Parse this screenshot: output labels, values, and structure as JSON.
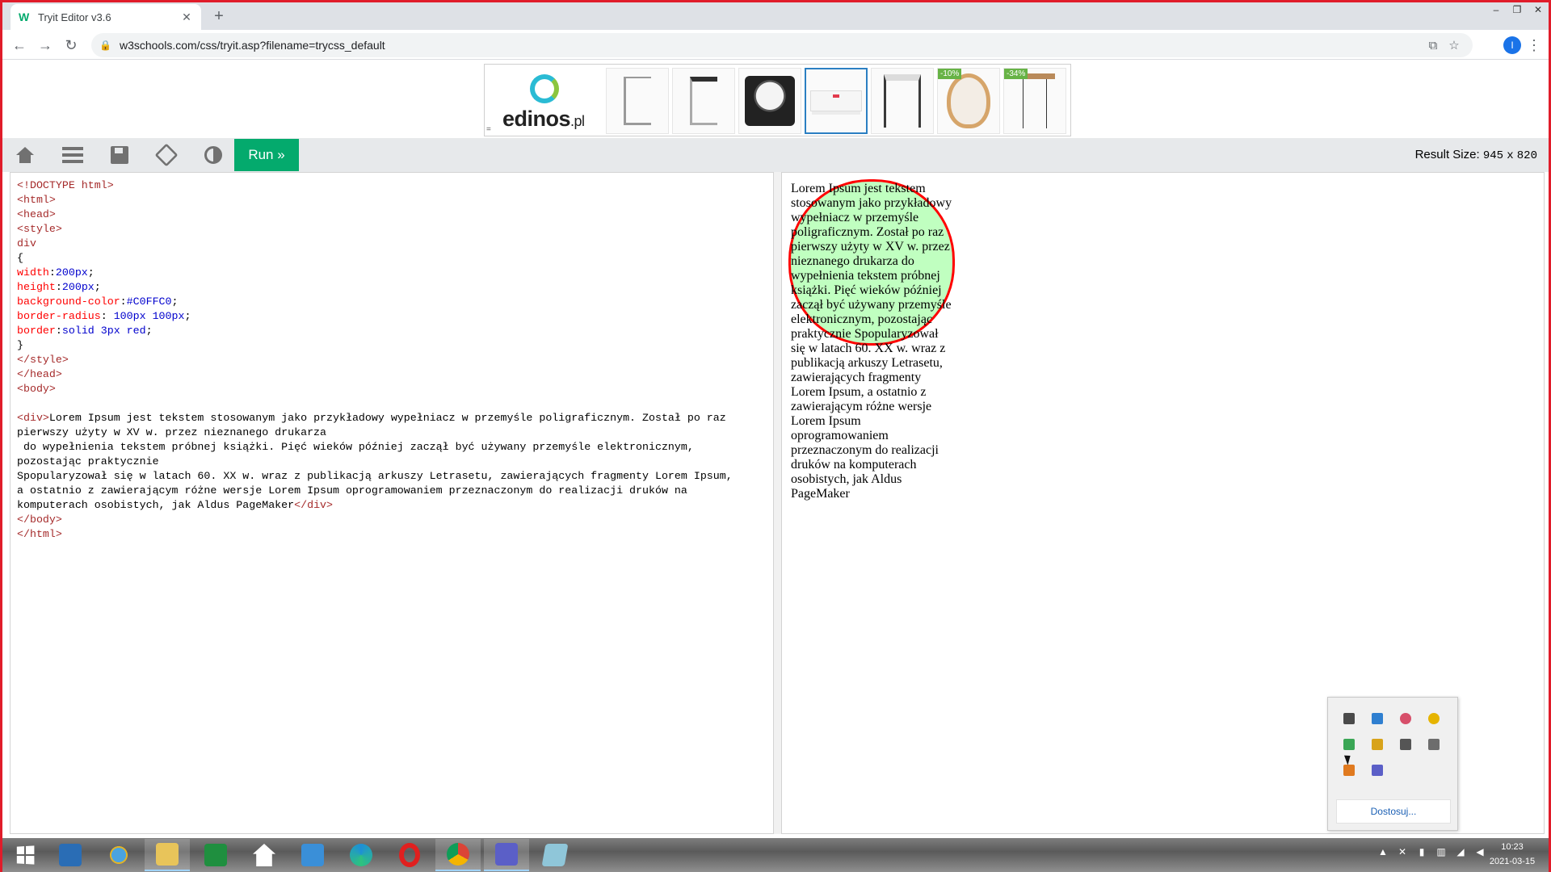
{
  "browser": {
    "tab_title": "Tryit Editor v3.6",
    "favicon_text": "W",
    "tab_close": "✕",
    "new_tab": "+",
    "window_controls": [
      "–",
      "❐",
      "✕"
    ],
    "url": "w3schools.com/css/tryit.asp?filename=trycss_default",
    "profile_initial": "I"
  },
  "ad": {
    "brand": "edinos",
    "brand_suffix": ".pl",
    "discount_badges": [
      "-10%",
      "-34%"
    ]
  },
  "tryit": {
    "run_label": "Run »",
    "result_size_label": "Result Size:",
    "result_width": "945",
    "result_times": "x",
    "result_height": "820"
  },
  "code": {
    "lines": [
      "<!DOCTYPE html>",
      "<html>",
      "<head>",
      "<style>",
      "div",
      "{",
      "width:200px;",
      "height:200px;",
      "background-color:#C0FFC0;",
      "border-radius: 100px 100px;",
      "border:solid 3px red;",
      "}",
      "</style>",
      "</head>",
      "<body>",
      "",
      "<div>Lorem Ipsum jest tekstem stosowanym jako przykładowy wypełniacz w przemyśle poligraficznym. Został po raz",
      "pierwszy użyty w XV w. przez nieznanego drukarza",
      " do wypełnienia tekstem próbnej książki. Pięć wieków później zaczął być używany przemyśle elektronicznym,",
      "pozostając praktycznie",
      "Spopularyzował się w latach 60. XX w. wraz z publikacją arkuszy Letrasetu, zawierających fragmenty Lorem Ipsum,",
      "a ostatnio z zawierającym różne wersje Lorem Ipsum oprogramowaniem przeznaczonym do realizacji druków na",
      "komputerach osobistych, jak Aldus PageMaker</div>",
      "</body>",
      "</html>"
    ]
  },
  "result": {
    "text": "Lorem Ipsum jest tekstem stosowanym jako przykładowy wypełniacz w przemyśle poligraficznym. Został po raz pierwszy użyty w XV w. przez nieznanego drukarza do wypełnienia tekstem próbnej książki. Pięć wieków później zaczął być używany przemyśle elektronicznym, pozostając praktycznie Spopularyzował się w latach 60. XX w. wraz z publikacją arkuszy Letrasetu, zawierających fragmenty Lorem Ipsum, a ostatnio z zawierającym różne wersje Lorem Ipsum oprogramowaniem przeznaczonym do realizacji druków na komputerach osobistych, jak Aldus PageMaker",
    "div_background": "#C0FFC0",
    "div_border_color": "#ff0000"
  },
  "tray_popup": {
    "customize_label": "Dostosuj..."
  },
  "taskbar": {
    "time": "10:23",
    "date": "2021-03-15"
  },
  "colors": {
    "run_green": "#04aa6d",
    "screen_border": "#e01c2a",
    "toolbar_gray": "#e7e9eb"
  }
}
